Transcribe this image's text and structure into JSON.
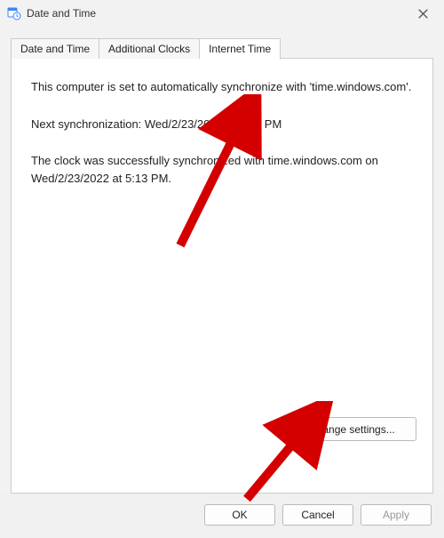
{
  "window": {
    "title": "Date and Time"
  },
  "tabs": {
    "t0": "Date and Time",
    "t1": "Additional Clocks",
    "t2": "Internet Time"
  },
  "panel": {
    "sync_intro": "This computer is set to automatically synchronize with 'time.windows.com'.",
    "next_sync": "Next synchronization: Wed/2/23/2022 at 7:41 PM",
    "last_sync": "The clock was successfully synchronized with time.windows.com on Wed/2/23/2022 at 5:13 PM.",
    "change_label": "Change settings..."
  },
  "footer": {
    "ok": "OK",
    "cancel": "Cancel",
    "apply": "Apply"
  },
  "icons": {
    "app": "calendar-clock-icon",
    "shield": "shield-icon",
    "close": "close-icon"
  },
  "colors": {
    "arrow": "#d40000",
    "shield_blue": "#3a86ff",
    "shield_yellow": "#ffb400"
  }
}
